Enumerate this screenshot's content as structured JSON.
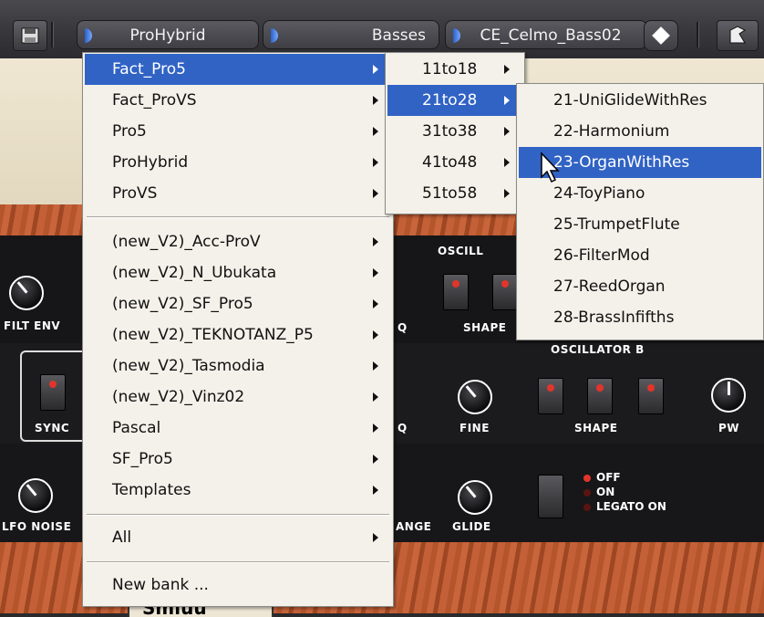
{
  "toolbar": {
    "bank_label": "ProHybrid",
    "category_label": "Basses",
    "preset_label": "CE_Celmo_Bass02",
    "icons": [
      "save-preset-icon",
      "preset-up-down-icon",
      "browse-icon"
    ]
  },
  "menu_main": {
    "banks": [
      {
        "label": "Fact_Pro5",
        "selected": true,
        "submenu": true
      },
      {
        "label": "Fact_ProVS",
        "selected": false,
        "submenu": true
      },
      {
        "label": "Pro5",
        "selected": false,
        "submenu": true
      },
      {
        "label": "ProHybrid",
        "selected": false,
        "submenu": true
      },
      {
        "label": "ProVS",
        "selected": false,
        "submenu": true
      }
    ],
    "user_banks": [
      {
        "label": "(new_V2)_Acc-ProV",
        "submenu": true
      },
      {
        "label": "(new_V2)_N_Ubukata",
        "submenu": true
      },
      {
        "label": "(new_V2)_SF_Pro5",
        "submenu": true
      },
      {
        "label": "(new_V2)_TEKNOTANZ_P5",
        "submenu": true
      },
      {
        "label": "(new_V2)_Tasmodia",
        "submenu": true
      },
      {
        "label": "(new_V2)_Vinz02",
        "submenu": true
      },
      {
        "label": "Pascal",
        "submenu": true
      },
      {
        "label": "SF_Pro5",
        "submenu": true
      },
      {
        "label": "Templates",
        "submenu": true
      }
    ],
    "all_label": "All",
    "new_bank_label": "New bank ..."
  },
  "menu_ranges": {
    "items": [
      {
        "label": "11to18",
        "selected": false
      },
      {
        "label": "21to28",
        "selected": true
      },
      {
        "label": "31to38",
        "selected": false
      },
      {
        "label": "41to48",
        "selected": false
      },
      {
        "label": "51to58",
        "selected": false
      }
    ]
  },
  "menu_presets": {
    "items": [
      {
        "label": "21-UniGlideWithRes",
        "selected": false
      },
      {
        "label": "22-Harmonium",
        "selected": false
      },
      {
        "label": "23-OrganWithRes",
        "selected": true
      },
      {
        "label": "24-ToyPiano",
        "selected": false
      },
      {
        "label": "25-TrumpetFlute",
        "selected": false
      },
      {
        "label": "26-FilterMod",
        "selected": false
      },
      {
        "label": "27-ReedOrgan",
        "selected": false
      },
      {
        "label": "28-BrassInfifths",
        "selected": false
      }
    ]
  },
  "synth_panel": {
    "filt_env_label": "FILT ENV",
    "sync_label": "SYNC",
    "lfo_noise_label": "LFO NOISE",
    "osc_a_label": "OSCILL",
    "osc_b_label": "OSCILLATOR B",
    "q_label": "Q",
    "q2_label": "Q",
    "shape_label": "SHAPE",
    "shape_b_label": "SHAPE",
    "fine_label": "FINE",
    "pw_label": "PW",
    "range_label": "ANGE",
    "glide_label": "GLIDE",
    "glide_modes": [
      "OFF",
      "ON",
      "LEGATO ON"
    ],
    "bottom_partial_label": "Smiuu"
  },
  "colors": {
    "menu_highlight": "#3163c5",
    "menu_bg": "#f4f1ea",
    "led_red": "#e3342b"
  }
}
